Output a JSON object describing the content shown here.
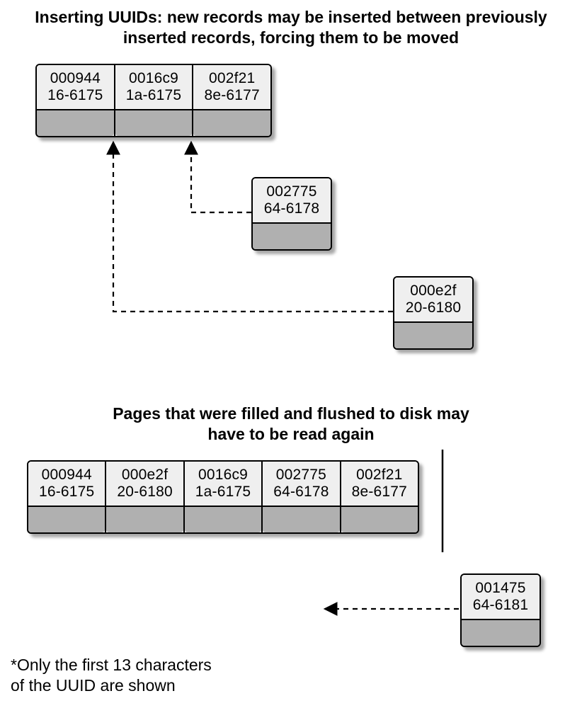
{
  "headings": {
    "top_line1": "Inserting UUIDs:  new records may be inserted between previously",
    "top_line2": "inserted records, forcing them to be moved",
    "mid_line1": "Pages that were filled and flushed to disk may",
    "mid_line2": "have to be read again"
  },
  "footnote": {
    "line1": "*Only the first 13 characters",
    "line2": "of the UUID are shown"
  },
  "top_block": {
    "cells": [
      {
        "l1": "000944",
        "l2": "16-6175"
      },
      {
        "l1": "0016c9",
        "l2": "1a-6175"
      },
      {
        "l1": "002f21",
        "l2": "8e-6177"
      }
    ]
  },
  "incoming": [
    {
      "l1": "002775",
      "l2": "64-6178"
    },
    {
      "l1": "000e2f",
      "l2": "20-6180"
    }
  ],
  "bottom_block": {
    "cells": [
      {
        "l1": "000944",
        "l2": "16-6175"
      },
      {
        "l1": "000e2f",
        "l2": "20-6180"
      },
      {
        "l1": "0016c9",
        "l2": "1a-6175"
      },
      {
        "l1": "002775",
        "l2": "64-6178"
      },
      {
        "l1": "002f21",
        "l2": "8e-6177"
      }
    ]
  },
  "new_record": {
    "l1": "001475",
    "l2": "64-6181"
  }
}
